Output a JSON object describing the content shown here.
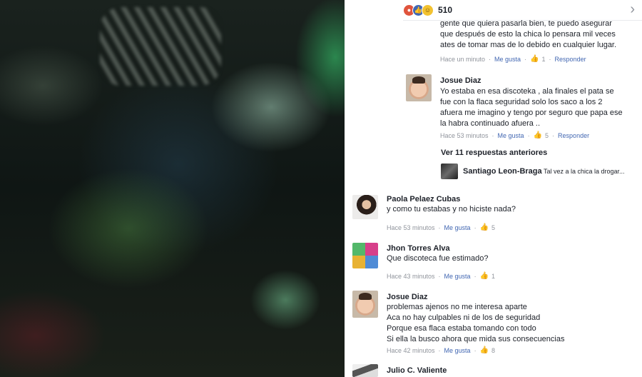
{
  "reactions": {
    "icons": [
      "angry",
      "like",
      "haha"
    ],
    "count": "510"
  },
  "comments": {
    "c0": {
      "text": "gente que quiera pasarla bien, te puedo asegurar\nque después de esto la chica lo pensara mil veces\nates de tomar mas de lo debido en cualquier lugar.",
      "time": "Hace un minuto",
      "like": "Me gusta",
      "likes": "1",
      "reply": "Responder"
    },
    "c1": {
      "name": "Josue Diaz",
      "text": "Yo  estaba en esa discoteka , ala finales el pata se\nfue con la flaca seguridad solo los saco a los 2\nafuera me imagino y tengo por seguro que papa ese\nla habra continuado afuera ..",
      "time": "Hace 53 minutos",
      "like": "Me gusta",
      "likes": "5",
      "reply": "Responder"
    },
    "more_replies": "Ver 11 respuestas anteriores",
    "preview": {
      "name": "Santiago Leon-Braga",
      "text": "Tal vez a la chica la drogar..."
    },
    "c2": {
      "name": "Paola Pelaez Cubas",
      "text": "y como tu estabas y no hiciste nada?",
      "time": "Hace 53 minutos",
      "like": "Me gusta",
      "likes": "5"
    },
    "c3": {
      "name": "Jhon Torres Alva",
      "text": "Que discoteca fue estimado?",
      "time": "Hace 43 minutos",
      "like": "Me gusta",
      "likes": "1"
    },
    "c4": {
      "name": "Josue Diaz",
      "text": "problemas ajenos no me interesa aparte\nAca no hay culpables ni de los de seguridad\nPorque esa flaca estaba tomando con todo\nSi ella la busco ahora que mida sus consecuencias",
      "time": "Hace 42 minutos",
      "like": "Me gusta",
      "likes": "8"
    },
    "c5": {
      "name": "Julio C. Valiente"
    }
  }
}
